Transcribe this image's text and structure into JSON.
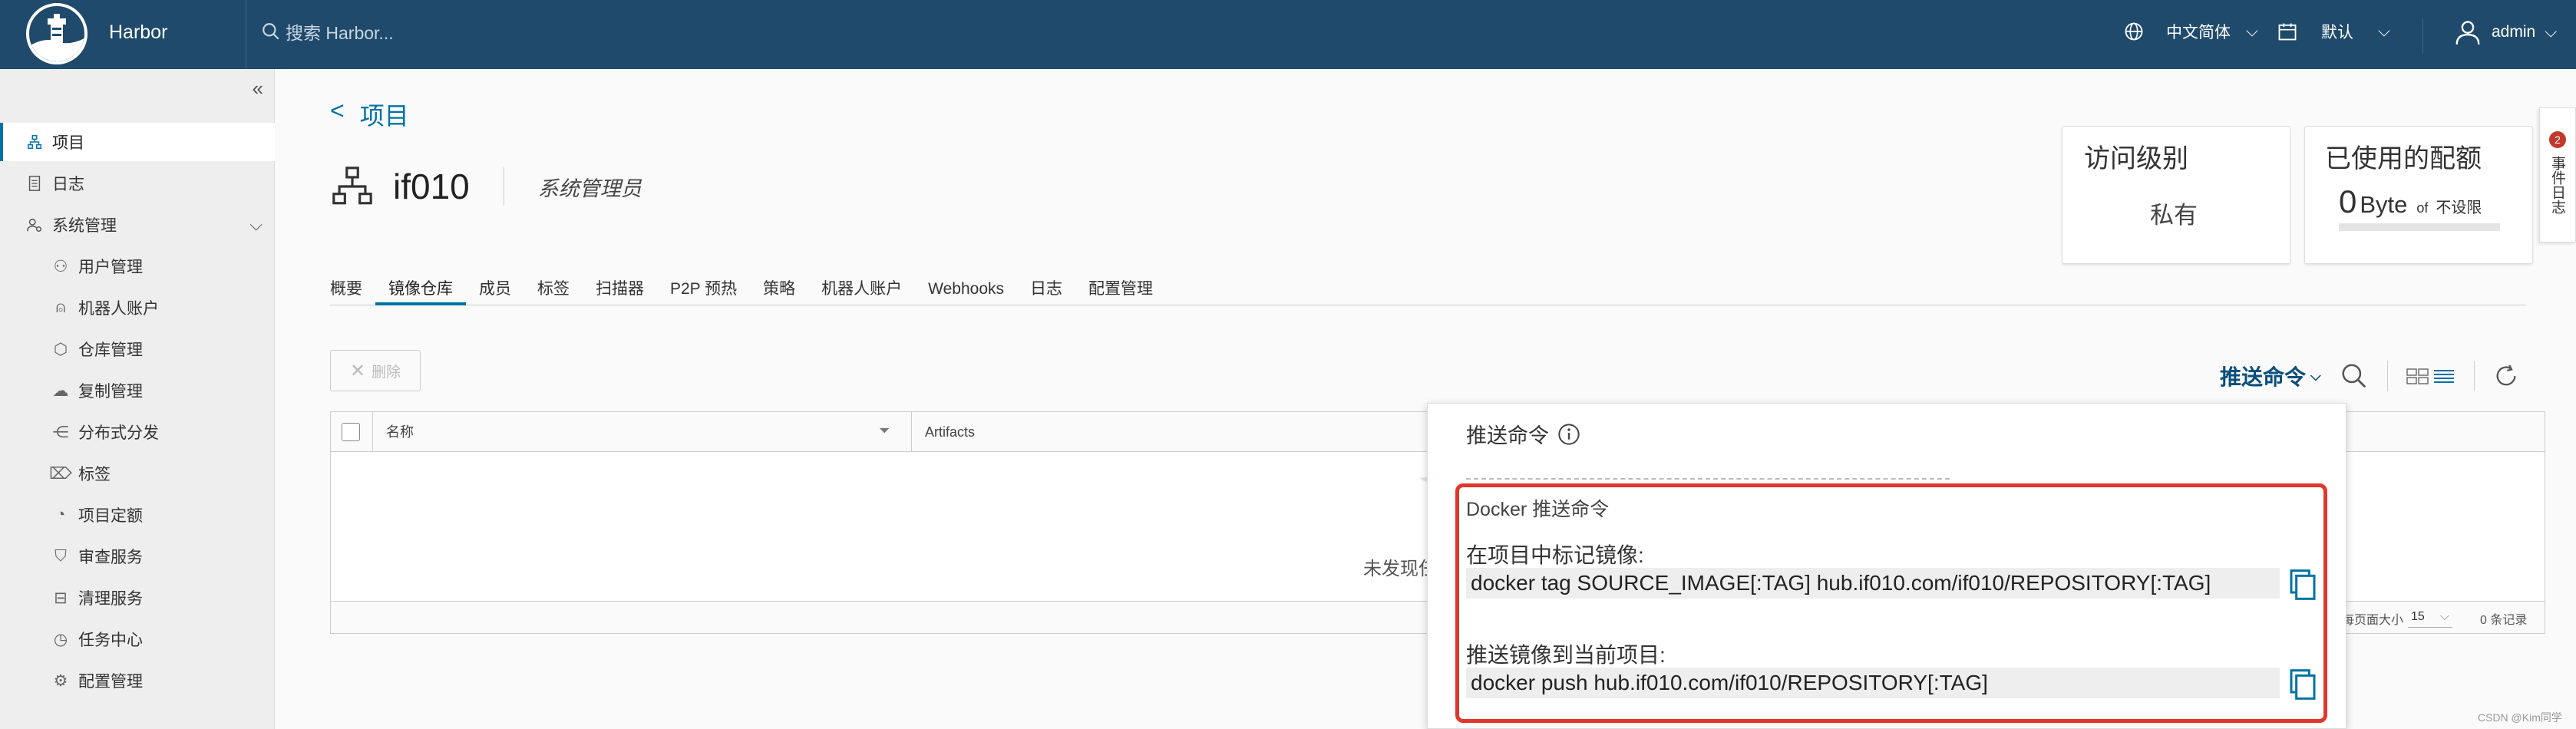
{
  "header": {
    "brand": "Harbor",
    "search_placeholder": "搜索 Harbor...",
    "language": "中文简体",
    "theme": "默认",
    "user": "admin"
  },
  "sidebar": {
    "items": [
      {
        "label": "项目",
        "icon": "project-icon",
        "active": true
      },
      {
        "label": "日志",
        "icon": "log-icon"
      },
      {
        "label": "系统管理",
        "icon": "admin-icon",
        "expandable": true
      }
    ],
    "sub_items": [
      {
        "label": "用户管理",
        "icon": "users-icon"
      },
      {
        "label": "机器人账户",
        "icon": "robot-icon"
      },
      {
        "label": "仓库管理",
        "icon": "registry-icon"
      },
      {
        "label": "复制管理",
        "icon": "replication-icon"
      },
      {
        "label": "分布式分发",
        "icon": "distribution-icon"
      },
      {
        "label": "标签",
        "icon": "tag-icon"
      },
      {
        "label": "项目定额",
        "icon": "quota-icon"
      },
      {
        "label": "审查服务",
        "icon": "shield-icon"
      },
      {
        "label": "清理服务",
        "icon": "trash-icon"
      },
      {
        "label": "任务中心",
        "icon": "task-icon"
      },
      {
        "label": "配置管理",
        "icon": "gear-icon"
      }
    ]
  },
  "main": {
    "back_label": "项目",
    "project_name": "if010",
    "project_role": "系统管理员",
    "access_card": {
      "title": "访问级别",
      "value": "私有"
    },
    "quota_card": {
      "title": "已使用的配额",
      "used_num": "0",
      "used_unit": "Byte",
      "of": "of",
      "limit": "不设限"
    },
    "tabs": [
      "概要",
      "镜像仓库",
      "成员",
      "标签",
      "扫描器",
      "P2P 预热",
      "策略",
      "机器人账户",
      "Webhooks",
      "日志",
      "配置管理"
    ],
    "active_tab": 1,
    "delete_label": "删除",
    "push_command_label": "推送命令",
    "table": {
      "columns": [
        "名称",
        "Artifacts"
      ],
      "empty_text": "未发现任",
      "page_size_label": "每页面大小",
      "page_size": "15",
      "record_count": "0 条记录"
    }
  },
  "popover": {
    "title": "推送命令",
    "section_title": "Docker 推送命令",
    "tag_label": "在项目中标记镜像:",
    "tag_command": "docker tag SOURCE_IMAGE[:TAG] hub.if010.com/if010/REPOSITORY[:TAG]",
    "push_label": "推送镜像到当前项目:",
    "push_command": "docker push hub.if010.com/if010/REPOSITORY[:TAG]"
  },
  "right_panel": {
    "badge": "2",
    "label": "事件日志"
  },
  "watermark": "CSDN @Kim同学",
  "colors": {
    "header_bg": "#1f4a6b",
    "accent": "#0072a3",
    "highlight_border": "#e0372d"
  }
}
